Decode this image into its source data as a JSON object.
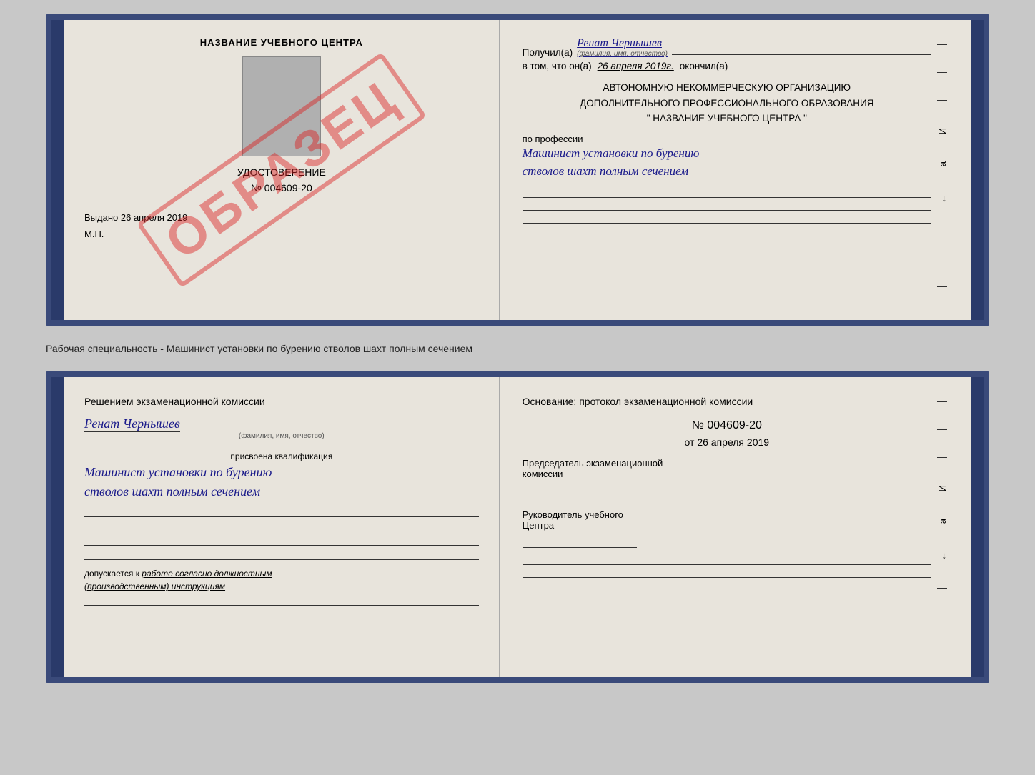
{
  "top_document": {
    "left": {
      "title": "НАЗВАНИЕ УЧЕБНОГО ЦЕНТРА",
      "photo_area_label": "фото",
      "stamp_text": "УДОСТОВЕРЕНИЕ",
      "cert_number": "№ 004609-20",
      "issued_label": "Выдано",
      "issued_date": "26 апреля 2019",
      "mp_label": "М.П.",
      "obrazec": "ОБРАЗЕЦ"
    },
    "right": {
      "received_label": "Получил(а)",
      "received_name": "Ренат Чернышев",
      "name_subtitle": "(фамилия, имя, отчество)",
      "date_prefix": "в том, что он(а)",
      "date_value": "26 апреля 2019г.",
      "date_suffix": "окончил(а)",
      "org_line1": "АВТОНОМНУЮ НЕКОММЕРЧЕСКУЮ ОРГАНИЗАЦИЮ",
      "org_line2": "ДОПОЛНИТЕЛЬНОГО ПРОФЕССИОНАЛЬНОГО ОБРАЗОВАНИЯ",
      "org_line3": "\" НАЗВАНИЕ УЧЕБНОГО ЦЕНТРА \"",
      "profession_label": "по профессии",
      "profession_value": "Машинист установки по бурению\nстволов шахт полным сечением"
    }
  },
  "separator": {
    "text": "Рабочая специальность - Машинист установки по бурению стволов шахт полным сечением"
  },
  "bottom_document": {
    "left": {
      "decision_text": "Решением экзаменационной комиссии",
      "name": "Ренат Чернышев",
      "name_subtitle": "(фамилия, имя, отчество)",
      "qualification_label": "присвоена квалификация",
      "qualification_value": "Машинист установки по бурению\nстволов шахт полным сечением",
      "допускается_label": "допускается к",
      "допускается_value": "работе согласно должностным\n(производственным) инструкциям"
    },
    "right": {
      "basis_label": "Основание: протокол экзаменационной комиссии",
      "protocol_number": "№ 004609-20",
      "protocol_date_prefix": "от",
      "protocol_date": "26 апреля 2019",
      "chairman_label": "Председатель экзаменационной\nкомиссии",
      "director_label": "Руководитель учебного\nЦентра"
    }
  },
  "colors": {
    "border": "#3a4a7a",
    "spine": "#2a3a6a",
    "background": "#e8e4dc",
    "name_color": "#1a1a8a",
    "obrazec_color": "rgba(220,30,30,0.45)",
    "text_color": "#222"
  }
}
